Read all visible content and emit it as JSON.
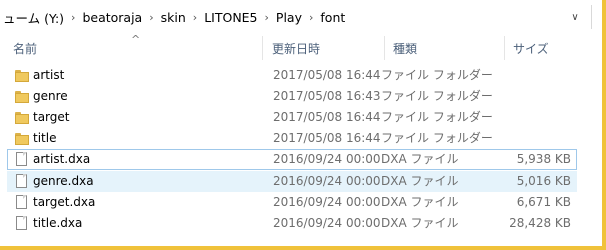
{
  "address": {
    "crumbs": [
      "ューム (Y:)",
      "beatoraja",
      "skin",
      "LITONE5",
      "Play",
      "font"
    ],
    "separator": "›",
    "dropdown": "∨"
  },
  "columns": {
    "name": "名前",
    "date": "更新日時",
    "type": "種類",
    "size": "サイズ",
    "sort_indicator": "^"
  },
  "files": [
    {
      "name": "artist",
      "date": "2017/05/08 16:44",
      "type": "ファイル フォルダー",
      "size": "",
      "icon": "folder-icon",
      "state": ""
    },
    {
      "name": "genre",
      "date": "2017/05/08 16:43",
      "type": "ファイル フォルダー",
      "size": "",
      "icon": "folder-icon",
      "state": ""
    },
    {
      "name": "target",
      "date": "2017/05/08 16:44",
      "type": "ファイル フォルダー",
      "size": "",
      "icon": "folder-icon",
      "state": ""
    },
    {
      "name": "title",
      "date": "2017/05/08 16:44",
      "type": "ファイル フォルダー",
      "size": "",
      "icon": "folder-icon",
      "state": ""
    },
    {
      "name": "artist.dxa",
      "date": "2016/09/24 00:00",
      "type": "DXA ファイル",
      "size": "5,938 KB",
      "icon": "file-icon",
      "state": "focused"
    },
    {
      "name": "genre.dxa",
      "date": "2016/09/24 00:00",
      "type": "DXA ファイル",
      "size": "5,016 KB",
      "icon": "file-icon",
      "state": "selected"
    },
    {
      "name": "target.dxa",
      "date": "2016/09/24 00:00",
      "type": "DXA ファイル",
      "size": "6,671 KB",
      "icon": "file-icon",
      "state": ""
    },
    {
      "name": "title.dxa",
      "date": "2016/09/24 00:00",
      "type": "DXA ファイル",
      "size": "28,428 KB",
      "icon": "file-icon",
      "state": ""
    }
  ]
}
